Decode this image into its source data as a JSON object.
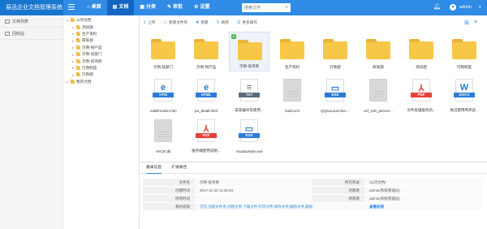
{
  "app": {
    "title": "易迅企业文档管理系统"
  },
  "topnav": [
    {
      "label": "桌面",
      "icon": "home-icon",
      "glyph": "⌂",
      "active": false
    },
    {
      "label": "文档",
      "icon": "document-icon",
      "glyph": "▤",
      "active": true
    },
    {
      "label": "分类",
      "icon": "grid-icon",
      "glyph": "▦",
      "active": false
    },
    {
      "label": "审批",
      "icon": "approval-icon",
      "glyph": "✎",
      "active": false
    },
    {
      "label": "设置",
      "icon": "gear-icon",
      "glyph": "⚙",
      "active": false
    }
  ],
  "search": {
    "placeholder": "搜索文件"
  },
  "user": {
    "name": "admin"
  },
  "sidebar": [
    {
      "label": "文档列表",
      "icon": "list-icon"
    },
    {
      "label": "回收站",
      "icon": "trash-icon"
    }
  ],
  "tree": {
    "root": "公司文档",
    "children": [
      "测试部",
      "生产资料",
      "研发部",
      "示例-财产品",
      "示例-技部门",
      "示例-技项目",
      "行政制度",
      "行政部"
    ],
    "mine": "我的文档"
  },
  "toolbar": [
    {
      "label": "上传",
      "icon": "upload-icon",
      "glyph": "⇪"
    },
    {
      "label": "新建文件夹",
      "icon": "new-folder-icon",
      "glyph": "▭"
    },
    {
      "label": "新建",
      "icon": "new-file-icon",
      "glyph": "✚"
    },
    {
      "label": "刷新",
      "icon": "refresh-icon",
      "glyph": "↻"
    },
    {
      "label": "更多操作",
      "icon": "more-icon",
      "glyph": "☰"
    }
  ],
  "files": [
    {
      "name": "示例-技部门",
      "kind": "folder"
    },
    {
      "name": "示例-财产品",
      "kind": "folder"
    },
    {
      "name": "示例-技项目",
      "kind": "folder",
      "selected": true
    },
    {
      "name": "生产资料",
      "kind": "folder"
    },
    {
      "name": "行政部",
      "kind": "folder"
    },
    {
      "name": "研发部",
      "kind": "folder"
    },
    {
      "name": "测试部",
      "kind": "folder"
    },
    {
      "name": "行政制度",
      "kind": "folder"
    },
    {
      "name": "AddEmotion.htm",
      "kind": "doc",
      "badge": "HTM",
      "glyph": "e",
      "color": "#2b7bd6"
    },
    {
      "name": "pa_detail.html",
      "kind": "doc",
      "badge": "HTML",
      "glyph": "e",
      "color": "#2b7bd6"
    },
    {
      "name": "安装编导及使用...",
      "kind": "doc",
      "badge": "TXT",
      "glyph": "≡",
      "color": "#5a6b7d"
    },
    {
      "name": "build.xml",
      "kind": "plain"
    },
    {
      "name": "QQSoLauncher....",
      "kind": "doc",
      "badge": "EXE",
      "glyph": "▭",
      "color": "#2b7bd6"
    },
    {
      "name": "cef_100_percen...",
      "kind": "plain"
    },
    {
      "name": "文件处理服务的...",
      "kind": "doc",
      "badge": "PDF",
      "glyph": "⅄",
      "color": "#e5413b"
    },
    {
      "name": "易迅使用简单说...",
      "kind": "doc",
      "badge": "DOCX",
      "glyph": "W",
      "color": "#2b7bd6"
    },
    {
      "name": "AFCtrl.dll",
      "kind": "plain"
    },
    {
      "name": "服务端使用说明...",
      "kind": "doc",
      "badge": "PDF",
      "glyph": "⅄",
      "color": "#e5413b"
    },
    {
      "name": "YoudaoNote.exe",
      "kind": "doc",
      "badge": "EXE",
      "glyph": "▭",
      "color": "#2b7bd6"
    }
  ],
  "panel": {
    "tabs": [
      "基本信息",
      "扩展属性"
    ],
    "labels": {
      "name": "文件名",
      "path": "所在目录",
      "created": "创建时间",
      "creator": "创建者",
      "modified": "修改时间",
      "modifier": "修改者",
      "perms": "我的权限",
      "settings_link": "查看权限"
    },
    "values": {
      "name": "示例-技项目",
      "path": "/公司文档/",
      "created": "2017-11-30 11:36:34",
      "creator": "admin(系统管理员)",
      "modified": "",
      "modifier": "admin(系统管理员)",
      "perms": "可见,创建文件夹,创建文件,下载文件,打印文件,修改文件,删除文件,删除文件夹,分享文件"
    }
  }
}
